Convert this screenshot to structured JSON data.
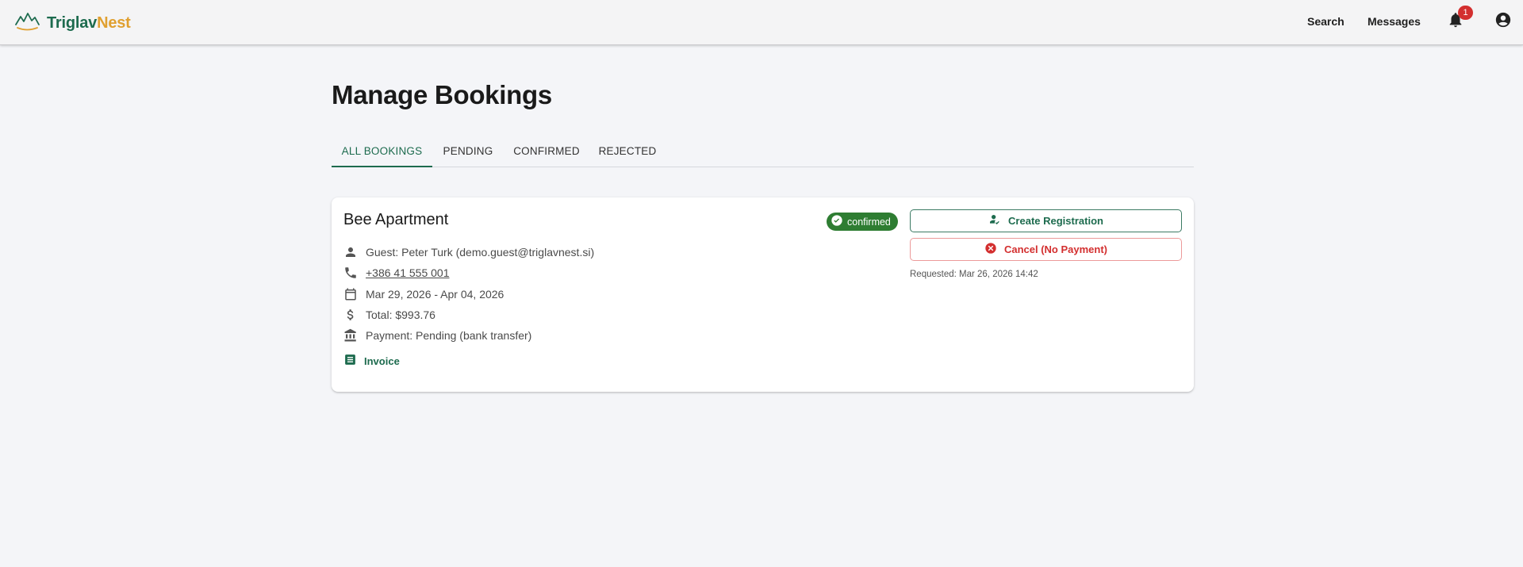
{
  "header": {
    "logo_part1": "Triglav",
    "logo_part2": "Nest",
    "nav_search": "Search",
    "nav_messages": "Messages",
    "notification_count": "1",
    "brand_colors": {
      "primary": "#1d6b4e",
      "accent": "#e0a030"
    }
  },
  "page": {
    "title": "Manage Bookings"
  },
  "tabs": [
    {
      "label": "ALL BOOKINGS",
      "active": true
    },
    {
      "label": "PENDING",
      "active": false
    },
    {
      "label": "CONFIRMED",
      "active": false
    },
    {
      "label": "REJECTED",
      "active": false
    }
  ],
  "booking": {
    "property_name": "Bee Apartment",
    "status": "confirmed",
    "guest": "Guest: Peter Turk (demo.guest@triglavnest.si)",
    "phone": "+386 41 555 001",
    "dates": "Mar 29, 2026 - Apr 04, 2026",
    "total": "Total: $993.76",
    "payment": "Payment: Pending (bank transfer)",
    "invoice_label": "Invoice",
    "create_registration_label": "Create Registration",
    "cancel_label": "Cancel (No Payment)",
    "requested": "Requested: Mar 26, 2026 14:42",
    "status_color": "#2e7d32",
    "danger_color": "#d32f2f"
  },
  "icons": {
    "guest": "person-icon",
    "phone": "phone-icon",
    "dates": "calendar-icon",
    "total": "dollar-icon",
    "payment": "bank-icon",
    "invoice": "receipt-icon"
  }
}
